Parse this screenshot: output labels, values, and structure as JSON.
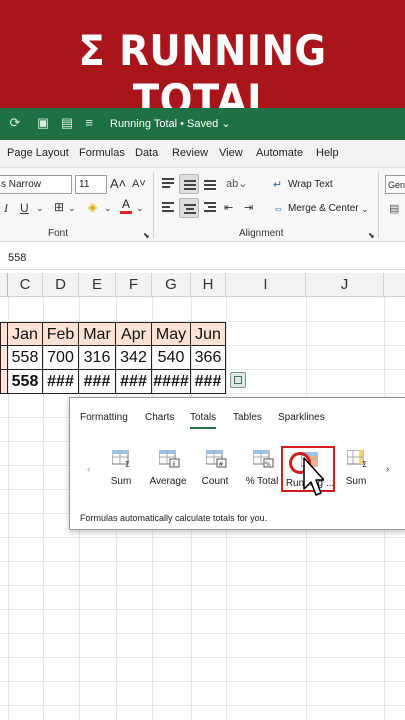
{
  "banner": {
    "title": "Σ RUNNING TOTAL",
    "color": "#a8151b"
  },
  "titlebar": {
    "title": "Running Total • Saved ⌄",
    "color": "#1e7145"
  },
  "menu": [
    "Page Layout",
    "Formulas",
    "Data",
    "Review",
    "View",
    "Automate",
    "Help"
  ],
  "ribbon": {
    "font_name": "s Narrow",
    "font_size": "11",
    "font_group": "Font",
    "alignment_group": "Alignment",
    "wrap_text": "Wrap Text",
    "merge_center": "Merge & Center",
    "number_format": "Gen"
  },
  "formula_bar": {
    "value": "558"
  },
  "columns": [
    "C",
    "D",
    "E",
    "F",
    "G",
    "H",
    "I",
    "J"
  ],
  "table": {
    "headers": [
      "Jan",
      "Feb",
      "Mar",
      "Apr",
      "May",
      "Jun"
    ],
    "values": [
      "558",
      "700",
      "316",
      "342",
      "540",
      "366"
    ],
    "totals": [
      "558",
      "###",
      "###",
      "###",
      "####",
      "###"
    ],
    "header_fill": "#fbe2d5"
  },
  "quick_analysis": {
    "tabs": [
      "Formatting",
      "Charts",
      "Totals",
      "Tables",
      "Sparklines"
    ],
    "active_tab": "Totals",
    "tiles": [
      "Sum",
      "Average",
      "Count",
      "% Total",
      "Running ...",
      "Sum"
    ],
    "selected_tile": "Running ...",
    "footer": "Formulas automatically calculate totals for you.",
    "highlight_color": "#d61d1d"
  }
}
